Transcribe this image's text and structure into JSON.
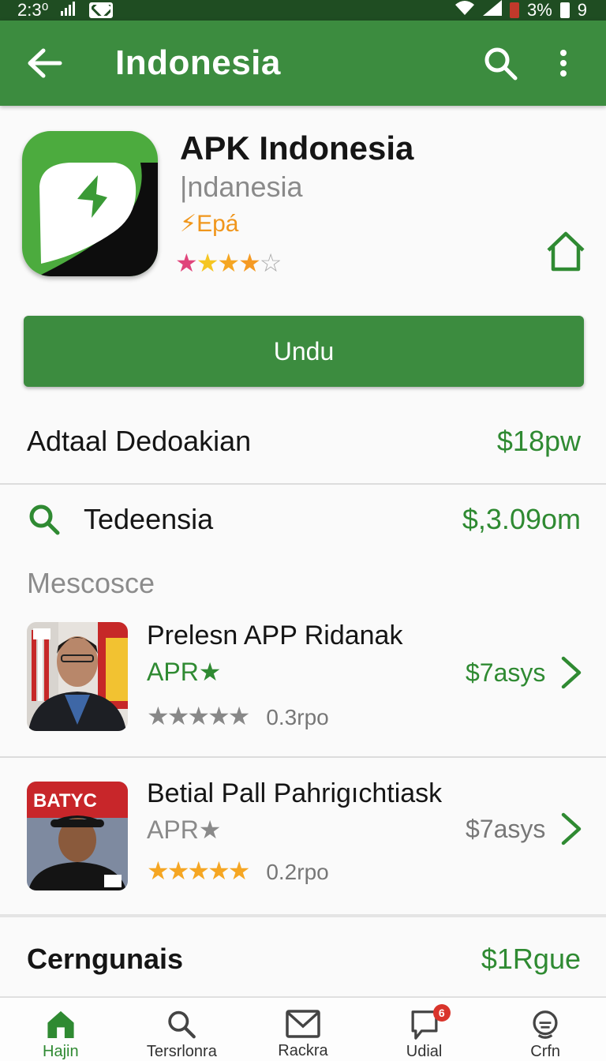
{
  "status_bar": {
    "time": "2:3⁰",
    "battery": "3%",
    "extra": "9"
  },
  "app_bar": {
    "title": "Indonesia"
  },
  "app": {
    "name": "APK Indonesia",
    "subtitle": "|ndanesia",
    "developer": "⚡Epá",
    "rating_stars": "★★★★★",
    "rating_value": 4
  },
  "install_button": {
    "label": "Undu"
  },
  "info_rows": [
    {
      "label": "Adtaal Dedoakian",
      "value": "$18pw"
    },
    {
      "label": "Tedeensia",
      "value": "$,3.09om"
    }
  ],
  "section": {
    "title": "Mescosce"
  },
  "list": [
    {
      "title": "Prelesn APP Ridanak",
      "tag": "APR★",
      "price": "$7asys",
      "stars": "★★★★★",
      "count": "0.3rpo"
    },
    {
      "title": "Betial Pall Pahrigıchtiask",
      "tag": "APR★",
      "price": "$7asys",
      "stars": "★★★★★",
      "count": "0.2rpo"
    }
  ],
  "footer_row": {
    "label": "Cerngunais",
    "value": "$1Rgue"
  },
  "bottom_nav": [
    {
      "label": "Hajin",
      "icon": "home-icon"
    },
    {
      "label": "Tersrlonra",
      "icon": "search-icon"
    },
    {
      "label": "Rackra",
      "icon": "mail-icon"
    },
    {
      "label": "Udial",
      "icon": "chat-icon",
      "badge": "6"
    },
    {
      "label": "Crfn",
      "icon": "support-icon"
    }
  ],
  "colors": {
    "primary": "#3c8c3f",
    "status_bar": "#1f4d22",
    "price_green": "#2f8a32",
    "star_orange": "#f5a623",
    "star_pink": "#e0457b",
    "dev_orange": "#f0961c"
  }
}
